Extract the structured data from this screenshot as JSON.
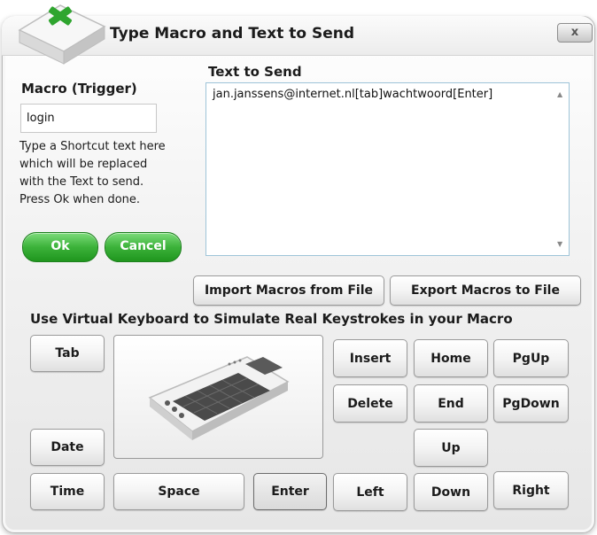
{
  "window": {
    "title": "Type Macro and Text to Send",
    "close_label": "x"
  },
  "macro": {
    "label": "Macro (Trigger)",
    "value": "login",
    "help_lines": [
      "Type a Shortcut text here",
      "which will be replaced",
      "with the Text to send.",
      "Press Ok when done."
    ]
  },
  "text_to_send": {
    "label": "Text to Send",
    "value": "jan.janssens@internet.nl[tab]wachtwoord[Enter]"
  },
  "buttons": {
    "ok": "Ok",
    "cancel": "Cancel",
    "import": "Import Macros from File",
    "export": "Export Macros to File"
  },
  "virtual_keyboard": {
    "heading": "Use Virtual Keyboard to Simulate Real Keystrokes in your Macro",
    "keys": {
      "tab": "Tab",
      "date": "Date",
      "time": "Time",
      "space": "Space",
      "enter": "Enter",
      "insert": "Insert",
      "home": "Home",
      "pgup": "PgUp",
      "delete": "Delete",
      "end": "End",
      "pgdown": "PgDown",
      "up": "Up",
      "left": "Left",
      "down": "Down",
      "right": "Right"
    }
  },
  "colors": {
    "accent_green": "#3cb23a",
    "logo_green": "#2fa52f",
    "text_border": "#9ec4d8"
  }
}
